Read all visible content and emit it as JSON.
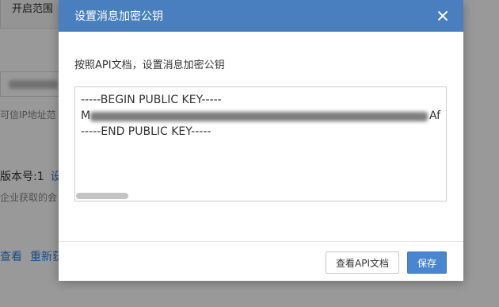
{
  "background": {
    "tab_label": "开启范围",
    "hint_text": "可信IP地址范",
    "version_label": "版本号:1",
    "version_link": "设",
    "corp_text": "企业获取的会",
    "action_view": "查看",
    "action_reget": "重新获"
  },
  "dialog": {
    "title": "设置消息加密公钥",
    "instruction": "按照API文档，设置消息加密公钥",
    "key_begin": "-----BEGIN PUBLIC KEY-----",
    "key_body_prefix": "M",
    "key_body_suffix": "Af",
    "key_end": "-----END PUBLIC KEY-----",
    "buttons": {
      "view_doc": "查看API文档",
      "save": "保存"
    }
  }
}
